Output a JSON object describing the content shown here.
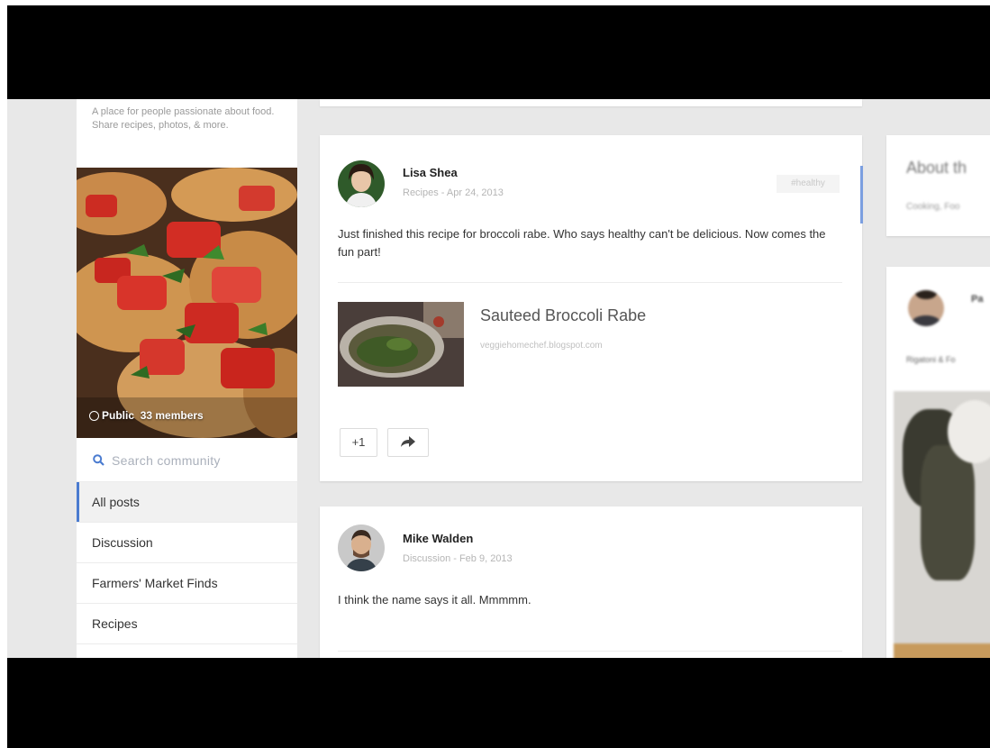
{
  "community": {
    "description": "A place for people passionate about food. Share recipes, photos, & more.",
    "visibility": "Public",
    "members": "33 members",
    "search_placeholder": "Search community",
    "nav": [
      {
        "label": "All posts",
        "active": true
      },
      {
        "label": "Discussion",
        "active": false
      },
      {
        "label": "Farmers' Market Finds",
        "active": false
      },
      {
        "label": "Recipes",
        "active": false
      }
    ]
  },
  "posts": [
    {
      "author": "Lisa Shea",
      "meta": "Recipes - Apr 24, 2013",
      "tag": "#healthy",
      "text": "Just finished this recipe for broccoli rabe. Who says healthy can't be delicious. Now comes the fun part!",
      "link_title": "Sauteed Broccoli Rabe",
      "link_url": "veggiehomechef.blogspot.com",
      "plus_label": "+1"
    },
    {
      "author": "Mike Walden",
      "meta": "Discussion - Feb 9, 2013",
      "text": "I think the name says it all. Mmmmm."
    }
  ],
  "sidebar_right": {
    "about_title": "About th",
    "about_text": "Cooking, Foo",
    "post_author": "Pa",
    "post_text": "Rigatoni & Fo"
  },
  "colors": {
    "accent": "#4a7bd0",
    "background": "#e8e8e8"
  }
}
